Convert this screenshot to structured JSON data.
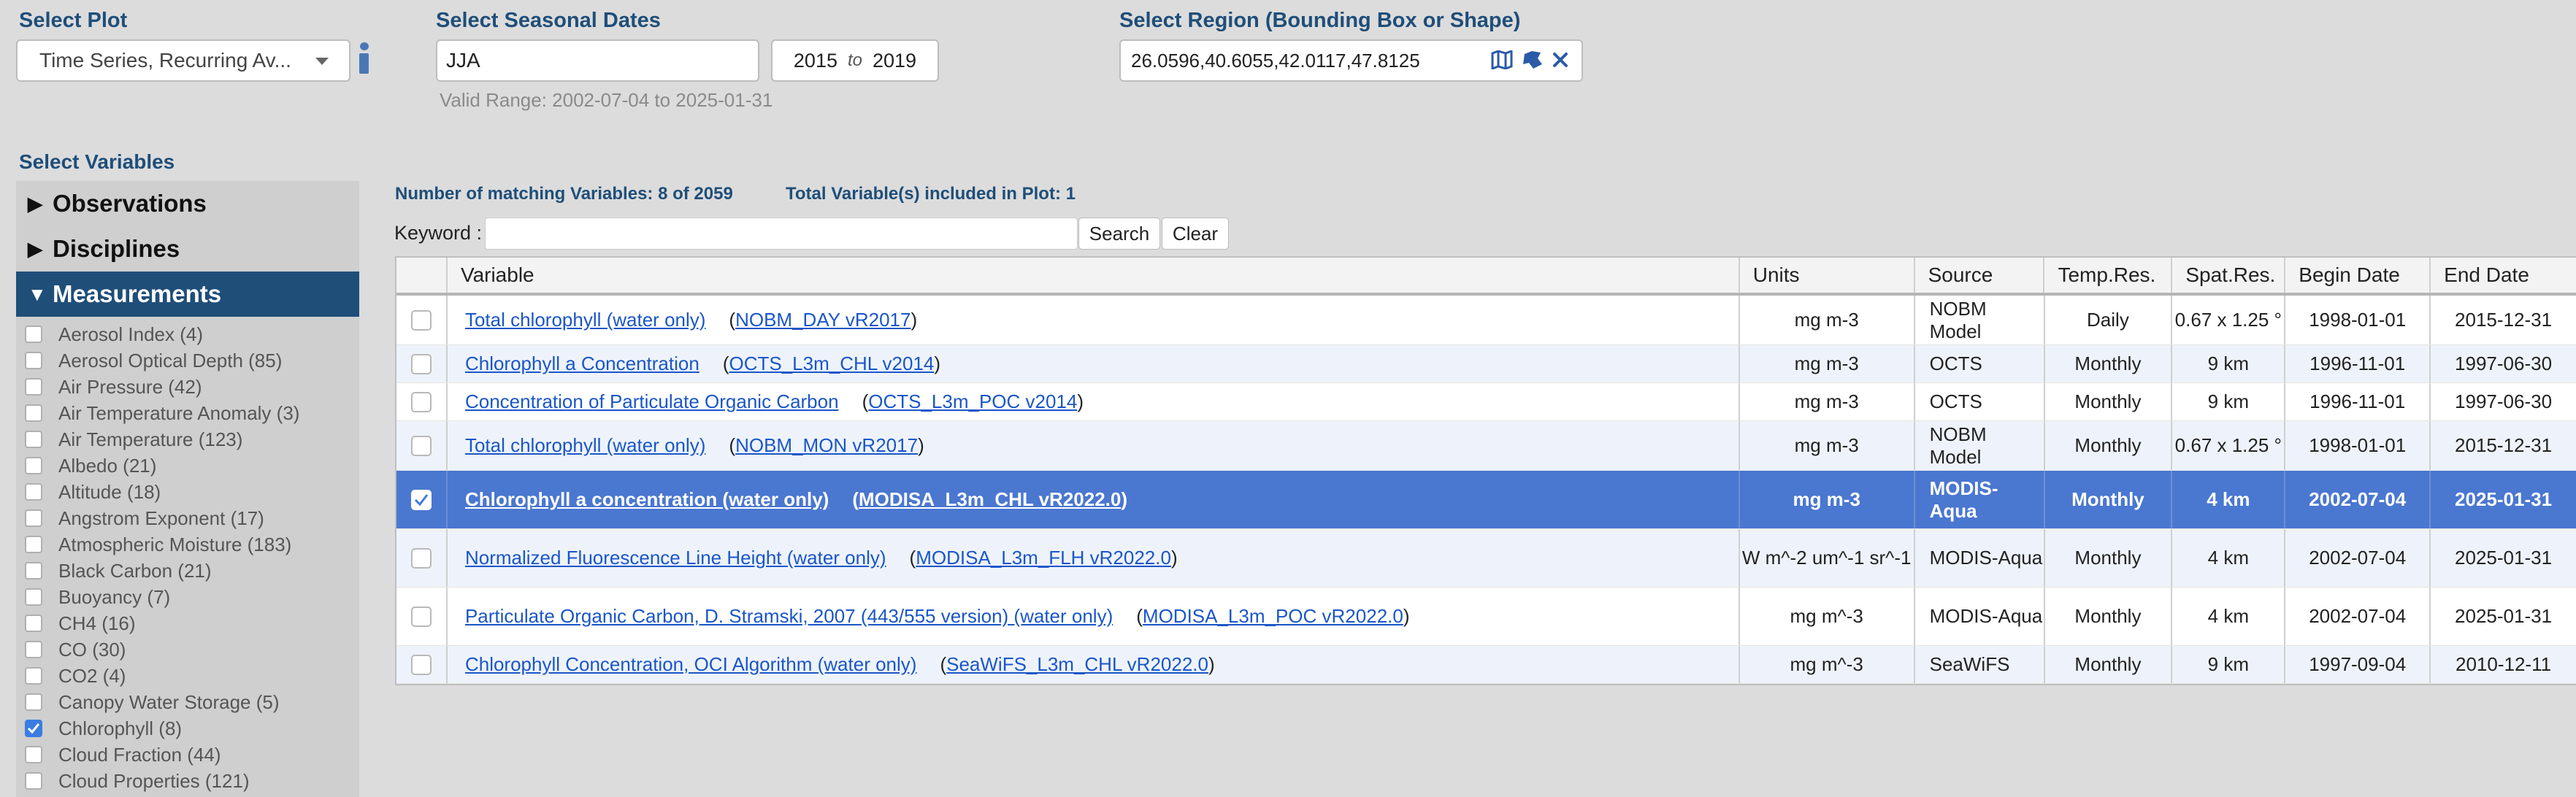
{
  "plot": {
    "title": "Select Plot",
    "value": "Time Series, Recurring Av..."
  },
  "seasonal": {
    "title": "Select Seasonal Dates",
    "season": "JJA",
    "start_year": "2015",
    "to_label": "to",
    "end_year": "2019",
    "valid_range": "Valid Range: 2002-07-04 to 2025-01-31"
  },
  "region": {
    "title": "Select Region (Bounding Box or Shape)",
    "value": "26.0596,40.6055,42.0117,47.8125"
  },
  "variables": {
    "title": "Select Variables",
    "categories": [
      {
        "label": "Observations",
        "expanded": false
      },
      {
        "label": "Disciplines",
        "expanded": false
      },
      {
        "label": "Measurements",
        "expanded": true
      }
    ],
    "measurements": [
      {
        "label": "Aerosol Index (4)",
        "checked": false
      },
      {
        "label": "Aerosol Optical Depth (85)",
        "checked": false
      },
      {
        "label": "Air Pressure (42)",
        "checked": false
      },
      {
        "label": "Air Temperature Anomaly (3)",
        "checked": false
      },
      {
        "label": "Air Temperature (123)",
        "checked": false
      },
      {
        "label": "Albedo (21)",
        "checked": false
      },
      {
        "label": "Altitude (18)",
        "checked": false
      },
      {
        "label": "Angstrom Exponent (17)",
        "checked": false
      },
      {
        "label": "Atmospheric Moisture (183)",
        "checked": false
      },
      {
        "label": "Black Carbon (21)",
        "checked": false
      },
      {
        "label": "Buoyancy (7)",
        "checked": false
      },
      {
        "label": "CH4 (16)",
        "checked": false
      },
      {
        "label": "CO (30)",
        "checked": false
      },
      {
        "label": "CO2 (4)",
        "checked": false
      },
      {
        "label": "Canopy Water Storage (5)",
        "checked": false
      },
      {
        "label": "Chlorophyll (8)",
        "checked": true
      },
      {
        "label": "Cloud Fraction (44)",
        "checked": false
      },
      {
        "label": "Cloud Properties (121)",
        "checked": false
      }
    ]
  },
  "results": {
    "matching": "Number of matching Variables: 8 of 2059",
    "included": "Total Variable(s) included in Plot: 1",
    "keyword_label": "Keyword :",
    "keyword_value": "",
    "search_label": "Search",
    "clear_label": "Clear",
    "columns": [
      "",
      "Variable",
      "Units",
      "Source",
      "Temp.Res.",
      "Spat.Res.",
      "Begin Date",
      "End Date"
    ],
    "rows": [
      {
        "checked": false,
        "variable": "Total chlorophyll (water only)",
        "dataset": "NOBM_DAY vR2017",
        "units": "mg m-3",
        "source": "NOBM Model",
        "temp_res": "Daily",
        "spat_res": "0.67 x 1.25 °",
        "begin": "1998-01-01",
        "end": "2015-12-31"
      },
      {
        "checked": false,
        "variable": "Chlorophyll a Concentration",
        "dataset": "OCTS_L3m_CHL v2014",
        "units": "mg m-3",
        "source": "OCTS",
        "temp_res": "Monthly",
        "spat_res": "9 km",
        "begin": "1996-11-01",
        "end": "1997-06-30"
      },
      {
        "checked": false,
        "variable": "Concentration of Particulate Organic Carbon",
        "dataset": "OCTS_L3m_POC v2014",
        "units": "mg m-3",
        "source": "OCTS",
        "temp_res": "Monthly",
        "spat_res": "9 km",
        "begin": "1996-11-01",
        "end": "1997-06-30"
      },
      {
        "checked": false,
        "variable": "Total chlorophyll (water only)",
        "dataset": "NOBM_MON vR2017",
        "units": "mg m-3",
        "source": "NOBM Model",
        "temp_res": "Monthly",
        "spat_res": "0.67 x 1.25 °",
        "begin": "1998-01-01",
        "end": "2015-12-31"
      },
      {
        "checked": true,
        "variable": "Chlorophyll a concentration (water only)",
        "dataset": "MODISA_L3m_CHL vR2022.0",
        "units": "mg m-3",
        "source": "MODIS-Aqua",
        "temp_res": "Monthly",
        "spat_res": "4 km",
        "begin": "2002-07-04",
        "end": "2025-01-31"
      },
      {
        "checked": false,
        "variable": "Normalized Fluorescence Line Height (water only)",
        "dataset": "MODISA_L3m_FLH vR2022.0",
        "units": "W m^-2 um^-1 sr^-1",
        "source": "MODIS-Aqua",
        "temp_res": "Monthly",
        "spat_res": "4 km",
        "begin": "2002-07-04",
        "end": "2025-01-31"
      },
      {
        "checked": false,
        "variable": "Particulate Organic Carbon, D. Stramski, 2007 (443/555 version) (water only)",
        "dataset": "MODISA_L3m_POC vR2022.0",
        "units": "mg m^-3",
        "source": "MODIS-Aqua",
        "temp_res": "Monthly",
        "spat_res": "4 km",
        "begin": "2002-07-04",
        "end": "2025-01-31"
      },
      {
        "checked": false,
        "variable": "Chlorophyll Concentration, OCI Algorithm (water only)",
        "dataset": "SeaWiFS_L3m_CHL vR2022.0",
        "units": "mg m^-3",
        "source": "SeaWiFS",
        "temp_res": "Monthly",
        "spat_res": "9 km",
        "begin": "1997-09-04",
        "end": "2010-12-11"
      }
    ]
  }
}
